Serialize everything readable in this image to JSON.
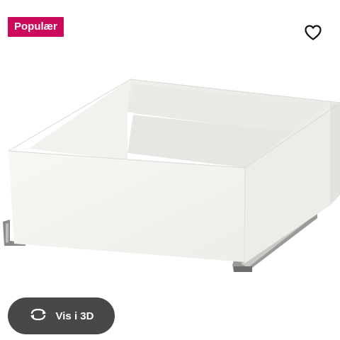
{
  "badge": {
    "label": "Populær",
    "color": "#cc0a5c"
  },
  "favorite": {
    "icon": "heart-outline-icon"
  },
  "product": {
    "image": "white-drawer-with-metal-runners"
  },
  "view3d": {
    "label": "Vis i 3D",
    "icon": "rotate-arrows-icon",
    "color": "#484848"
  }
}
